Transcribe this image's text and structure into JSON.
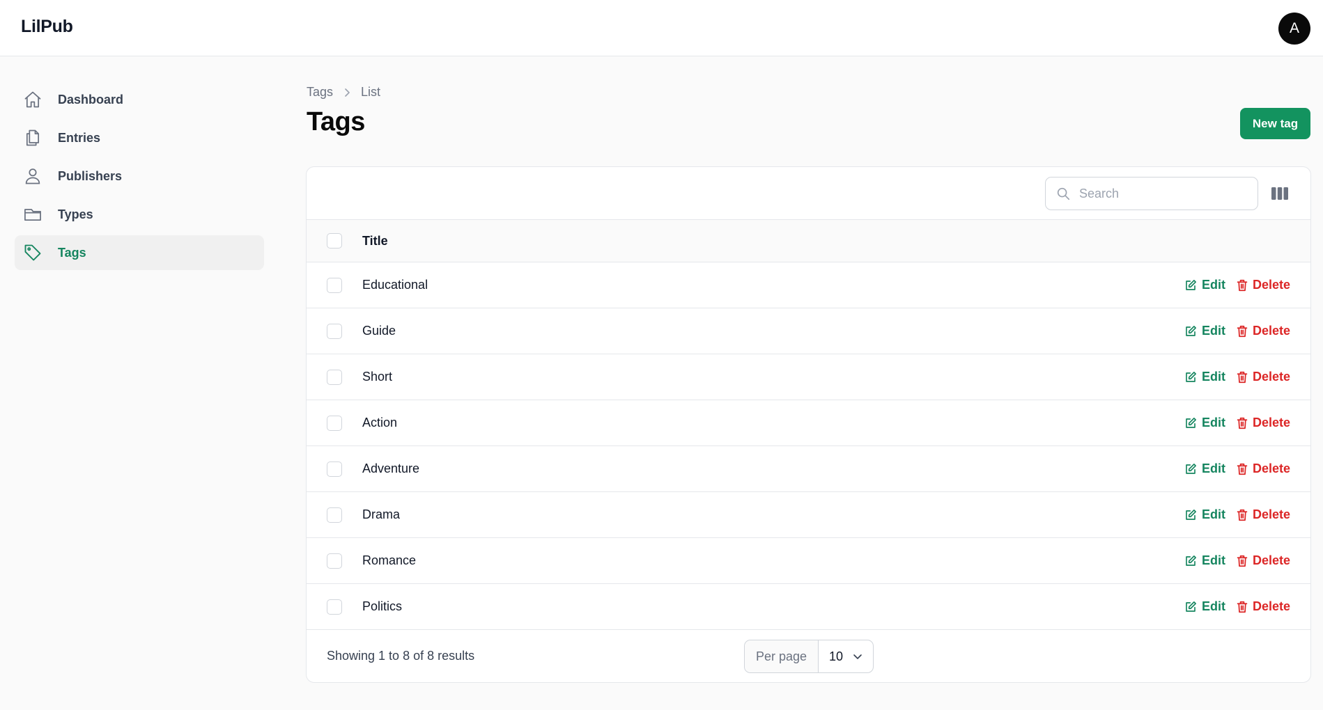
{
  "app": {
    "brand": "LilPub",
    "avatar_initial": "A"
  },
  "sidebar": {
    "items": [
      {
        "label": "Dashboard",
        "icon": "home-icon",
        "active": false
      },
      {
        "label": "Entries",
        "icon": "documents-icon",
        "active": false
      },
      {
        "label": "Publishers",
        "icon": "user-icon",
        "active": false
      },
      {
        "label": "Types",
        "icon": "folder-icon",
        "active": false
      },
      {
        "label": "Tags",
        "icon": "tag-icon",
        "active": true
      }
    ]
  },
  "breadcrumb": {
    "parent": "Tags",
    "current": "List"
  },
  "page": {
    "title": "Tags",
    "new_button": "New tag"
  },
  "table": {
    "search_placeholder": "Search",
    "column_title": "Title",
    "rows": [
      {
        "title": "Educational"
      },
      {
        "title": "Guide"
      },
      {
        "title": "Short"
      },
      {
        "title": "Action"
      },
      {
        "title": "Adventure"
      },
      {
        "title": "Drama"
      },
      {
        "title": "Romance"
      },
      {
        "title": "Politics"
      }
    ],
    "edit_label": "Edit",
    "delete_label": "Delete"
  },
  "pagination": {
    "summary": "Showing 1 to 8 of 8 results",
    "per_page_label": "Per page",
    "per_page_value": "10"
  },
  "colors": {
    "accent": "#13935f",
    "active_nav_text": "#15855f",
    "danger": "#dc2626"
  }
}
